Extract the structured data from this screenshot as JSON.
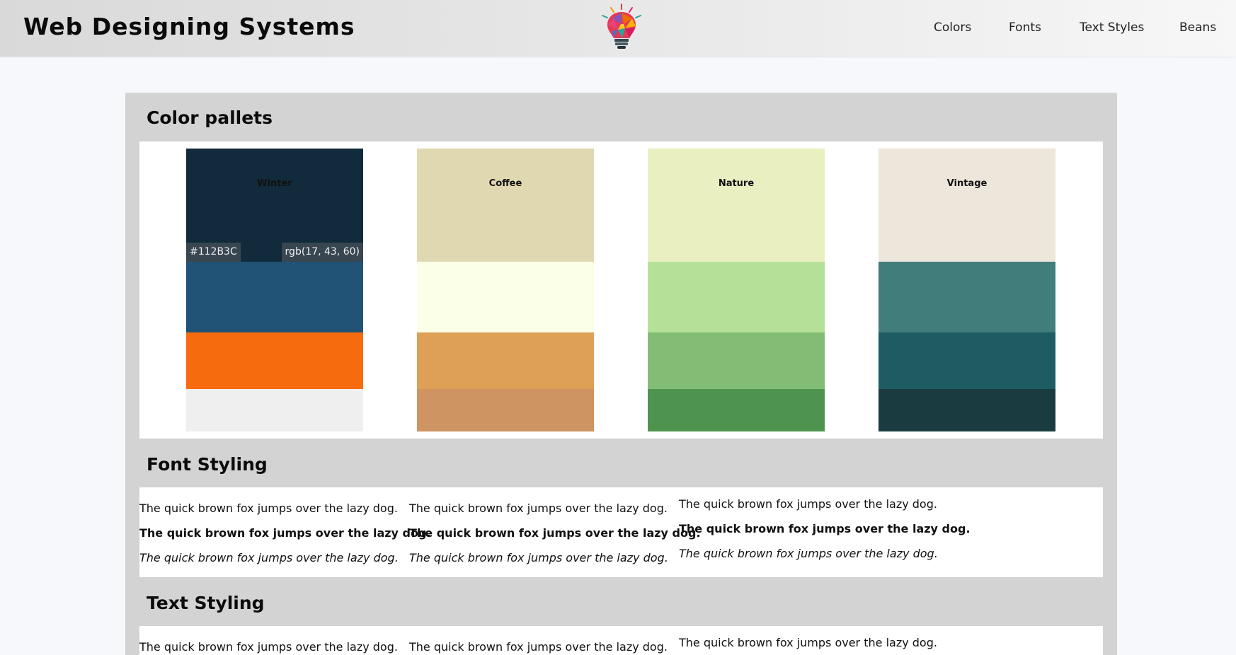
{
  "header": {
    "brand": "Web Designing Systems",
    "logo_icon": "lightbulb-icon",
    "nav": [
      "Colors",
      "Fonts",
      "Text Styles",
      "Beans"
    ]
  },
  "sections": {
    "colors_title": "Color pallets",
    "fonts_title": "Font Styling",
    "text_title": "Text Styling"
  },
  "palettes": [
    {
      "name": "Winter",
      "colors": [
        "#112B3C",
        "#205375",
        "#F66B0E",
        "#EFEFEF"
      ],
      "hex_label": "#112B3C",
      "rgb_label": "rgb(17, 43, 60)"
    },
    {
      "name": "Coffee",
      "colors": [
        "#E0D8B0",
        "#FCFFE7",
        "#DEA057",
        "#CE9461"
      ]
    },
    {
      "name": "Nature",
      "colors": [
        "#E9EFC0",
        "#B4E197",
        "#83BD75",
        "#4E944F"
      ]
    },
    {
      "name": "Vintage",
      "colors": [
        "#EDE6DB",
        "#417D7A",
        "#1D5C63",
        "#1A3C40"
      ]
    }
  ],
  "font_samples": {
    "sentence": "The quick brown fox jumps over the lazy dog."
  }
}
